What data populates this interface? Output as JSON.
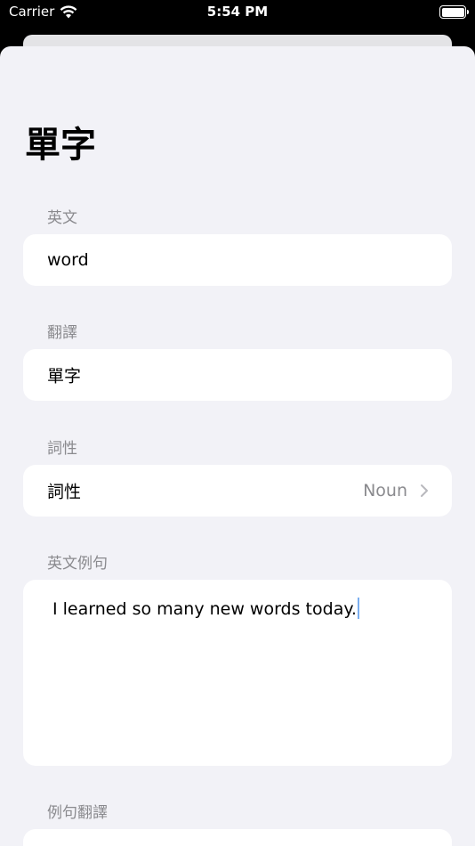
{
  "status_bar": {
    "carrier": "Carrier",
    "time": "5:54 PM"
  },
  "page": {
    "title": "單字"
  },
  "fields": {
    "english": {
      "label": "英文",
      "value": "word"
    },
    "translation": {
      "label": "翻譯",
      "value": "單字"
    },
    "part_of_speech": {
      "label": "詞性",
      "row_label": "詞性",
      "value": "Noun"
    },
    "example": {
      "label": "英文例句",
      "value": "I learned so many new words today."
    },
    "example_translation": {
      "label": "例句翻譯"
    }
  },
  "colors": {
    "background": "#f2f2f7",
    "card": "#ffffff",
    "secondary_text": "#8a8a8e",
    "caret": "#7aaef0"
  }
}
